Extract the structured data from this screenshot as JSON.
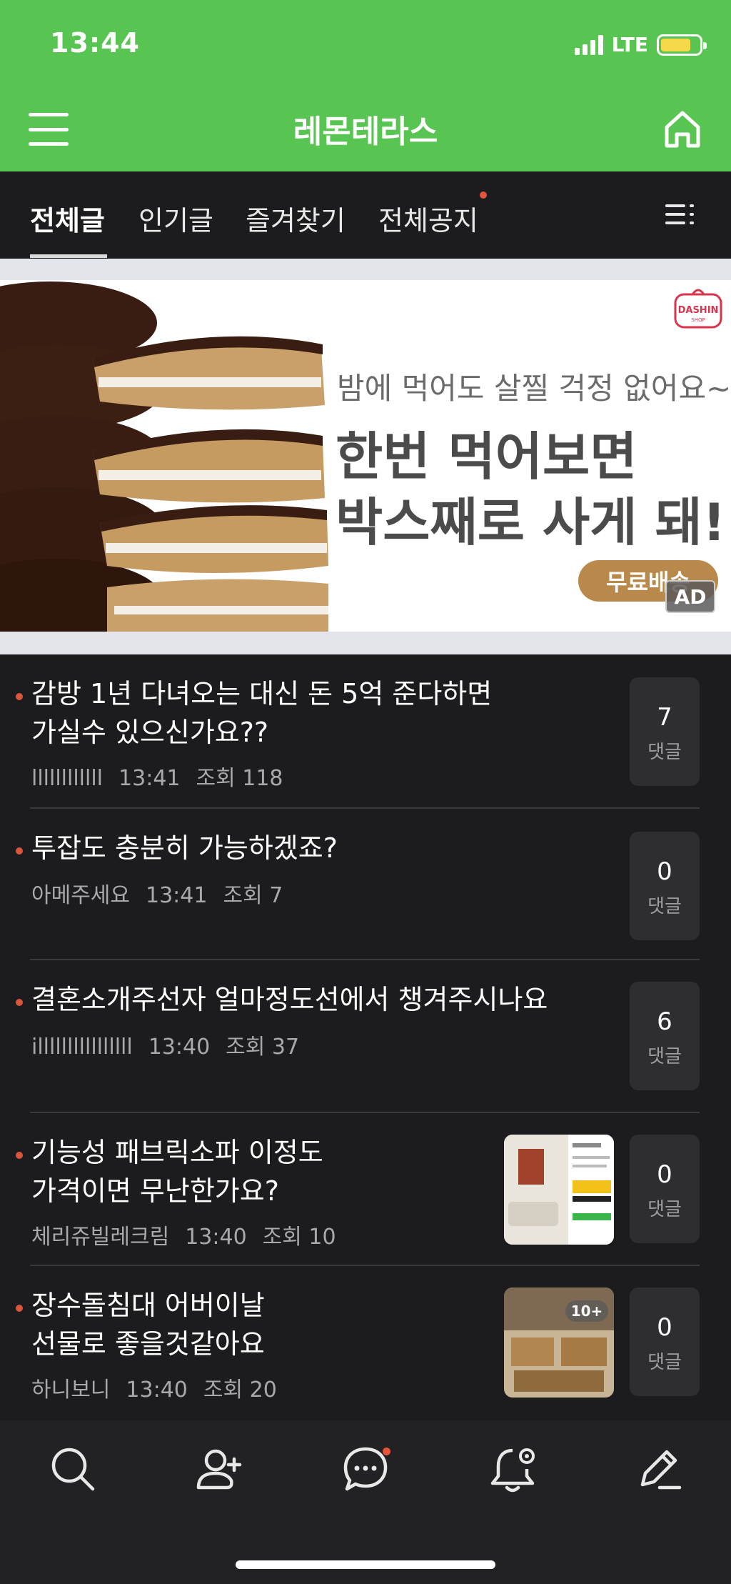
{
  "status_bar": {
    "time": "13:44",
    "network": "LTE",
    "battery_color": "#f5d94a"
  },
  "header": {
    "title": "레몬테라스",
    "bg_color": "#58c451"
  },
  "tabs": [
    {
      "label": "전체글",
      "active": true
    },
    {
      "label": "인기글",
      "active": false
    },
    {
      "label": "즐겨찾기",
      "active": false
    },
    {
      "label": "전체공지",
      "active": false,
      "has_new_dot": true
    }
  ],
  "ad": {
    "subtitle": "밤에 먹어도 살찔 걱정 없어요~",
    "headline_line1": "한번 먹어보면",
    "headline_line2": "박스째로 사게 돼!",
    "button_label": "무료배송",
    "badge": "AD",
    "brand_logo": "DASHIN",
    "brand_logo_sub": "SHOP"
  },
  "posts": [
    {
      "title_lines": [
        "감방 1년 다녀오는 대신 돈 5억 준다하면",
        "가실수 있으신가요??"
      ],
      "author": "llllllllllll",
      "time": "13:41",
      "views": "조회 118",
      "comments": "7",
      "comment_label": "댓글",
      "has_thumb": false
    },
    {
      "title_lines": [
        "투잡도 충분히 가능하겠죠?"
      ],
      "author": "아메주세요",
      "time": "13:41",
      "views": "조회 7",
      "comments": "0",
      "comment_label": "댓글",
      "has_thumb": false
    },
    {
      "title_lines": [
        "결혼소개주선자 얼마정도선에서 챙겨주시나요"
      ],
      "author": "illllllllllllllll",
      "time": "13:40",
      "views": "조회 37",
      "comments": "6",
      "comment_label": "댓글",
      "has_thumb": false
    },
    {
      "title_lines": [
        "기능성 패브릭소파 이정도",
        "가격이면 무난한가요?"
      ],
      "author": "체리쥬빌레크림",
      "time": "13:40",
      "views": "조회 10",
      "comments": "0",
      "comment_label": "댓글",
      "has_thumb": true
    },
    {
      "title_lines": [
        "장수돌침대 어버이날",
        "선물로 좋을것같아요"
      ],
      "author": "하니보니",
      "time": "13:40",
      "views": "조회 20",
      "comments": "0",
      "comment_label": "댓글",
      "has_thumb": true,
      "thumb_badge": "10+"
    }
  ],
  "bottom_nav": [
    {
      "icon": "search-icon"
    },
    {
      "icon": "add-friend-icon"
    },
    {
      "icon": "chat-icon",
      "has_new_dot": true
    },
    {
      "icon": "notification-settings-icon"
    },
    {
      "icon": "write-icon"
    }
  ]
}
